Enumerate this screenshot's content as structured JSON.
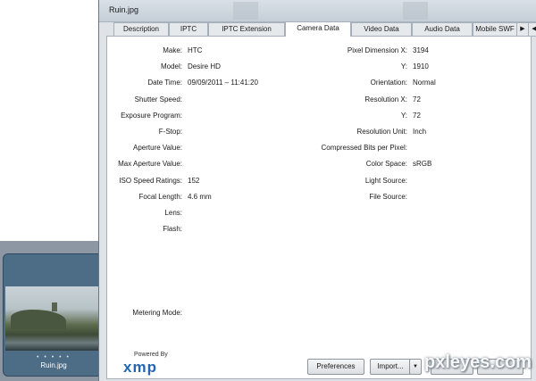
{
  "window": {
    "title": "Ruin.jpg"
  },
  "tabs": [
    {
      "label": "Description",
      "active": false
    },
    {
      "label": "IPTC",
      "active": false
    },
    {
      "label": "IPTC Extension",
      "active": false
    },
    {
      "label": "Camera Data",
      "active": true
    },
    {
      "label": "Video Data",
      "active": false
    },
    {
      "label": "Audio Data",
      "active": false
    },
    {
      "label": "Mobile SWF",
      "active": false
    }
  ],
  "tab_scroll": {
    "right": "▶",
    "left": "◀"
  },
  "left_fields": [
    {
      "label": "Make:",
      "value": "HTC"
    },
    {
      "label": "Model:",
      "value": "Desire HD"
    },
    {
      "label": "Date Time:",
      "value": "09/09/2011 – 11:41:20"
    },
    {
      "label": "Shutter Speed:",
      "value": ""
    },
    {
      "label": "Exposure Program:",
      "value": ""
    },
    {
      "label": "F-Stop:",
      "value": ""
    },
    {
      "label": "Aperture Value:",
      "value": ""
    },
    {
      "label": "Max Aperture Value:",
      "value": ""
    },
    {
      "label": "ISO Speed Ratings:",
      "value": "152"
    },
    {
      "label": "Focal Length:",
      "value": "4.6 mm"
    },
    {
      "label": "Lens:",
      "value": ""
    },
    {
      "label": "Flash:",
      "value": ""
    }
  ],
  "metering": {
    "label": "Metering Mode:",
    "value": ""
  },
  "right_fields": [
    {
      "label": "Pixel Dimension X:",
      "value": "3194"
    },
    {
      "label": "Y:",
      "value": "1910"
    },
    {
      "label": "Orientation:",
      "value": "Normal"
    },
    {
      "label": "Resolution X:",
      "value": "72"
    },
    {
      "label": "Y:",
      "value": "72"
    },
    {
      "label": "Resolution Unit:",
      "value": "Inch"
    },
    {
      "label": "Compressed Bits per Pixel:",
      "value": ""
    },
    {
      "label": "Color Space:",
      "value": "sRGB"
    },
    {
      "label": "Light Source:",
      "value": ""
    },
    {
      "label": "File Source:",
      "value": ""
    }
  ],
  "footer": {
    "powered_by": "Powered By",
    "logo": "xmp",
    "preferences_label": "Preferences",
    "import_label": "Import...",
    "import_arrow": "▼"
  },
  "thumbnail": {
    "label": "Ruin.jpg",
    "dots": "• • • • •"
  },
  "watermark": "pxleyes.com",
  "colors": {
    "accent": "#2366b2",
    "dialog_bg": "#dfe3e7",
    "thumb_panel": "#4d6d86"
  }
}
